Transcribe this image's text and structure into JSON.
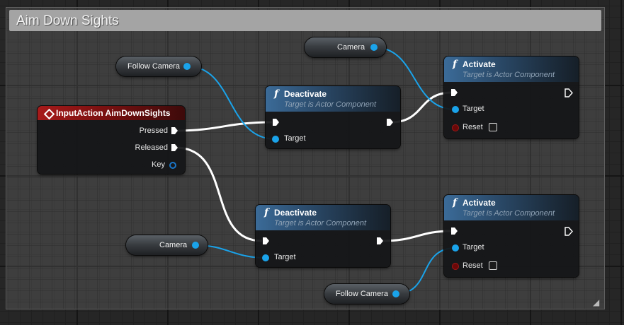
{
  "comment": {
    "title": "Aim Down Sights"
  },
  "input_action": {
    "title": "InputAction AimDownSights",
    "pins": {
      "pressed": "Pressed",
      "released": "Released",
      "key": "Key"
    }
  },
  "getters": {
    "camera_top": "Camera",
    "follow_camera_left": "Follow Camera",
    "camera_bottom": "Camera",
    "follow_camera_bottom": "Follow Camera"
  },
  "deactivate_top": {
    "title": "Deactivate",
    "subtitle": "Target is Actor Component",
    "target": "Target"
  },
  "deactivate_bottom": {
    "title": "Deactivate",
    "subtitle": "Target is Actor Component",
    "target": "Target"
  },
  "activate_top": {
    "title": "Activate",
    "subtitle": "Target is Actor Component",
    "target": "Target",
    "reset": "Reset"
  },
  "activate_bottom": {
    "title": "Activate",
    "subtitle": "Target is Actor Component",
    "target": "Target",
    "reset": "Reset"
  },
  "icons": {
    "function": "f",
    "event": "diamond-event-icon",
    "exec": "exec-arrow-icon"
  },
  "colors": {
    "object_pin": "#1aa3ea",
    "exec_wire": "#ffffff",
    "event_header": "#a71a1a",
    "function_header": "#3b6b98",
    "comment_header": "#a4a4a4"
  }
}
